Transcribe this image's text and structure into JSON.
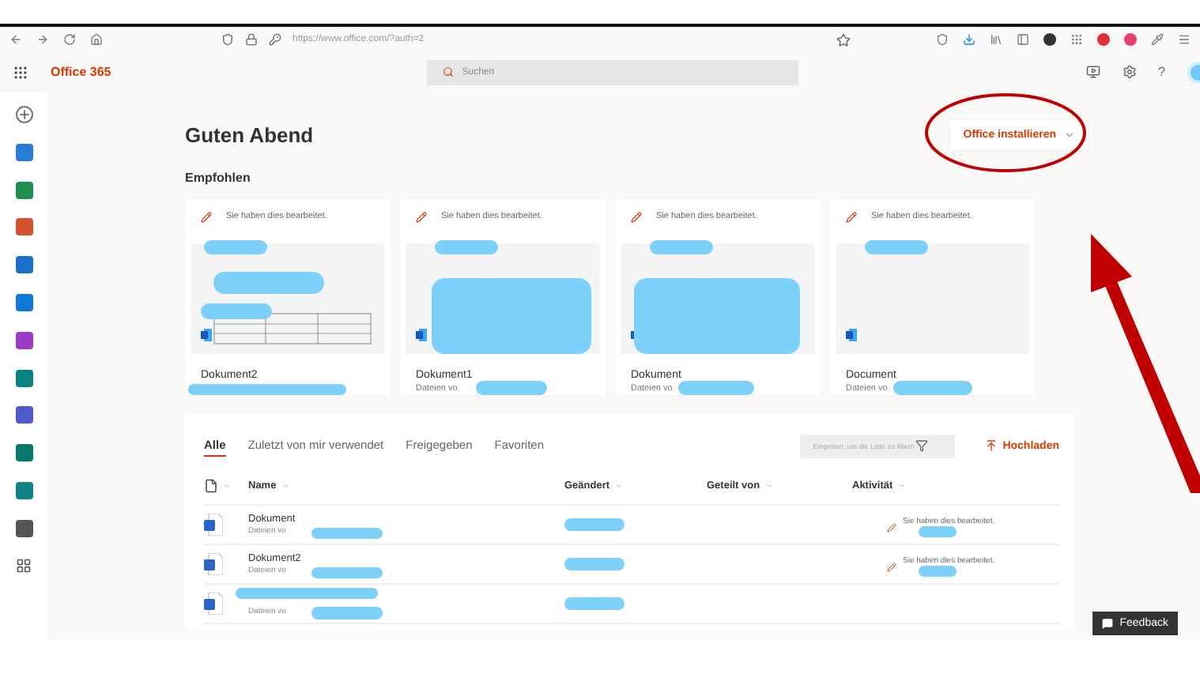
{
  "browser": {
    "url": "https://www.office.com/?auth=2"
  },
  "header": {
    "app_name": "Office 365",
    "search": {
      "placeholder": "Suchen"
    },
    "help": "?"
  },
  "greeting": "Guten Abend",
  "install_button": "Office installieren",
  "recommended": {
    "title": "Empfohlen",
    "cards": [
      {
        "activity": "Sie haben dies bearbeitet.",
        "title": "Dokument2"
      },
      {
        "activity": "Sie haben dies bearbeitet.",
        "title": "Dokument1",
        "subtitle": "Dateien vo"
      },
      {
        "activity": "Sie haben dies bearbeitet.",
        "title": "Dokument",
        "subtitle": "Dateien vo"
      },
      {
        "activity": "Sie haben dies bearbeitet.",
        "title": "Document",
        "subtitle": "Dateien vo"
      }
    ]
  },
  "files": {
    "tabs": [
      {
        "label": "Alle",
        "selected": true
      },
      {
        "label": "Zuletzt von mir verwendet",
        "selected": false
      },
      {
        "label": "Freigegeben",
        "selected": false
      },
      {
        "label": "Favoriten",
        "selected": false
      }
    ],
    "filter": {
      "placeholder": "Eingeben, um die Liste zu filtern"
    },
    "upload_button": "Hochladen",
    "columns": [
      "Name",
      "Geändert",
      "Geteilt von",
      "Aktivität"
    ],
    "rows": [
      {
        "name": "Dokument",
        "location": "Dateien vo",
        "activity": "Sie haben dies bearbeitet."
      },
      {
        "name": "Dokument2",
        "location": "Dateien vo",
        "activity": "Sie haben dies bearbeitet."
      },
      {
        "location": "Dateien vo"
      }
    ]
  },
  "feedback_button": "Feedback"
}
